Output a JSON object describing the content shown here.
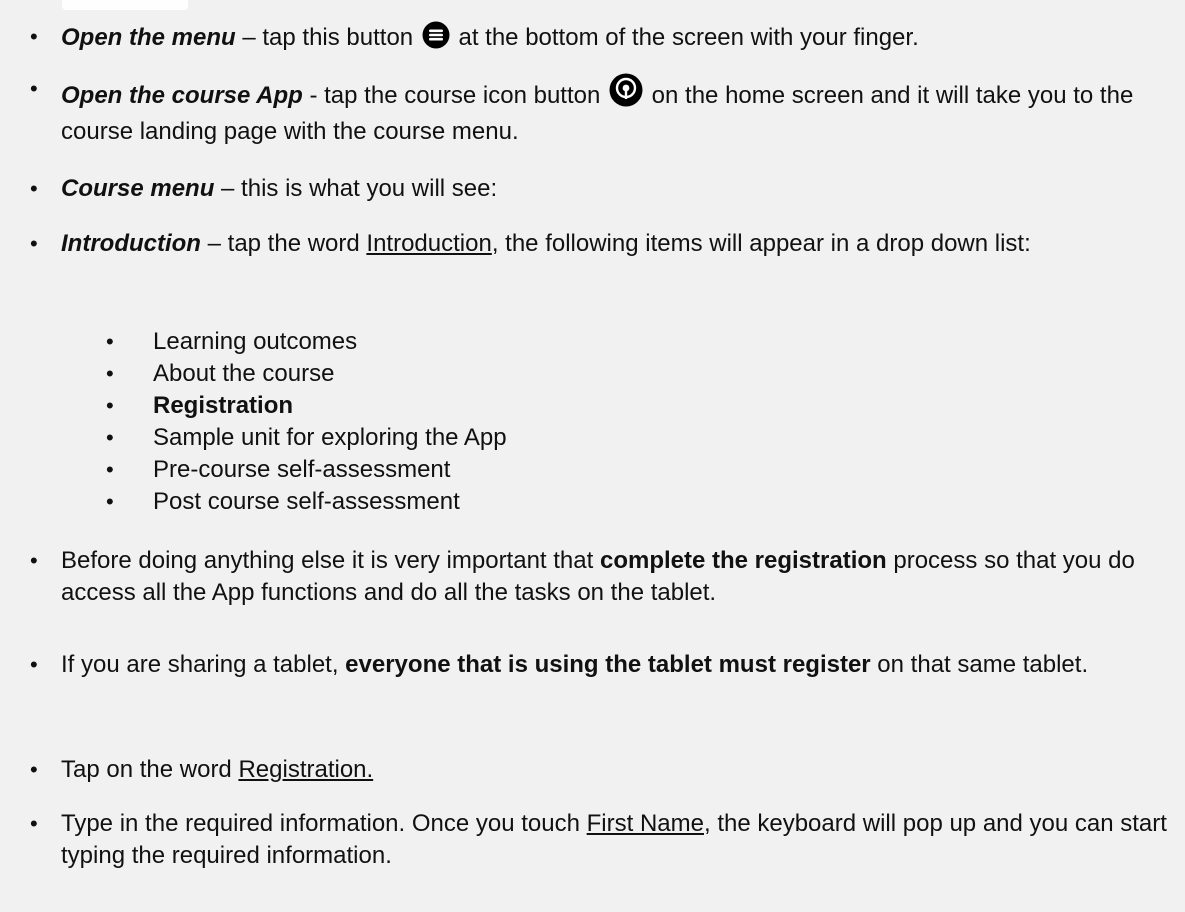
{
  "items": [
    {
      "lead": "Open the menu",
      "text_a": " – tap this button ",
      "text_b": " at the bottom of the screen with your finger."
    },
    {
      "lead": "Open the course App",
      "text_a": " - tap the course icon button ",
      "text_b": " on the home screen and it will take you to the course landing page with the course menu."
    },
    {
      "lead": "Course menu",
      "text_a": " – this is what you will see:"
    },
    {
      "lead": "Introduction",
      "text_a": " – tap the word ",
      "link": "Introduction",
      "text_b": ", the following items will appear in a drop down list:"
    }
  ],
  "dropdown_items": [
    "Learning outcomes",
    "About the course",
    "Registration",
    "Sample unit for exploring the App",
    "Pre-course self-assessment",
    "Post course self-assessment"
  ],
  "item5": {
    "text_a": "Before doing anything else it is very important that ",
    "bold": "complete the registration",
    "text_b": " process so that you do access all the App functions and do all the tasks on the tablet."
  },
  "item6": {
    "text_a": "If you are sharing a tablet, ",
    "bold": "everyone that is using the tablet must register",
    "text_b": " on that same tablet."
  },
  "item7": {
    "text_a": "Tap on the word ",
    "link": "Registration."
  },
  "item8": {
    "text_a": "Type in the required information. Once you touch ",
    "link": "First Name",
    "text_b": ", the keyboard will pop up and you can start typing the required information."
  },
  "icons": {
    "menu_button": "menu-button-icon",
    "course_app": "course-app-icon"
  },
  "bullet_char": "•"
}
